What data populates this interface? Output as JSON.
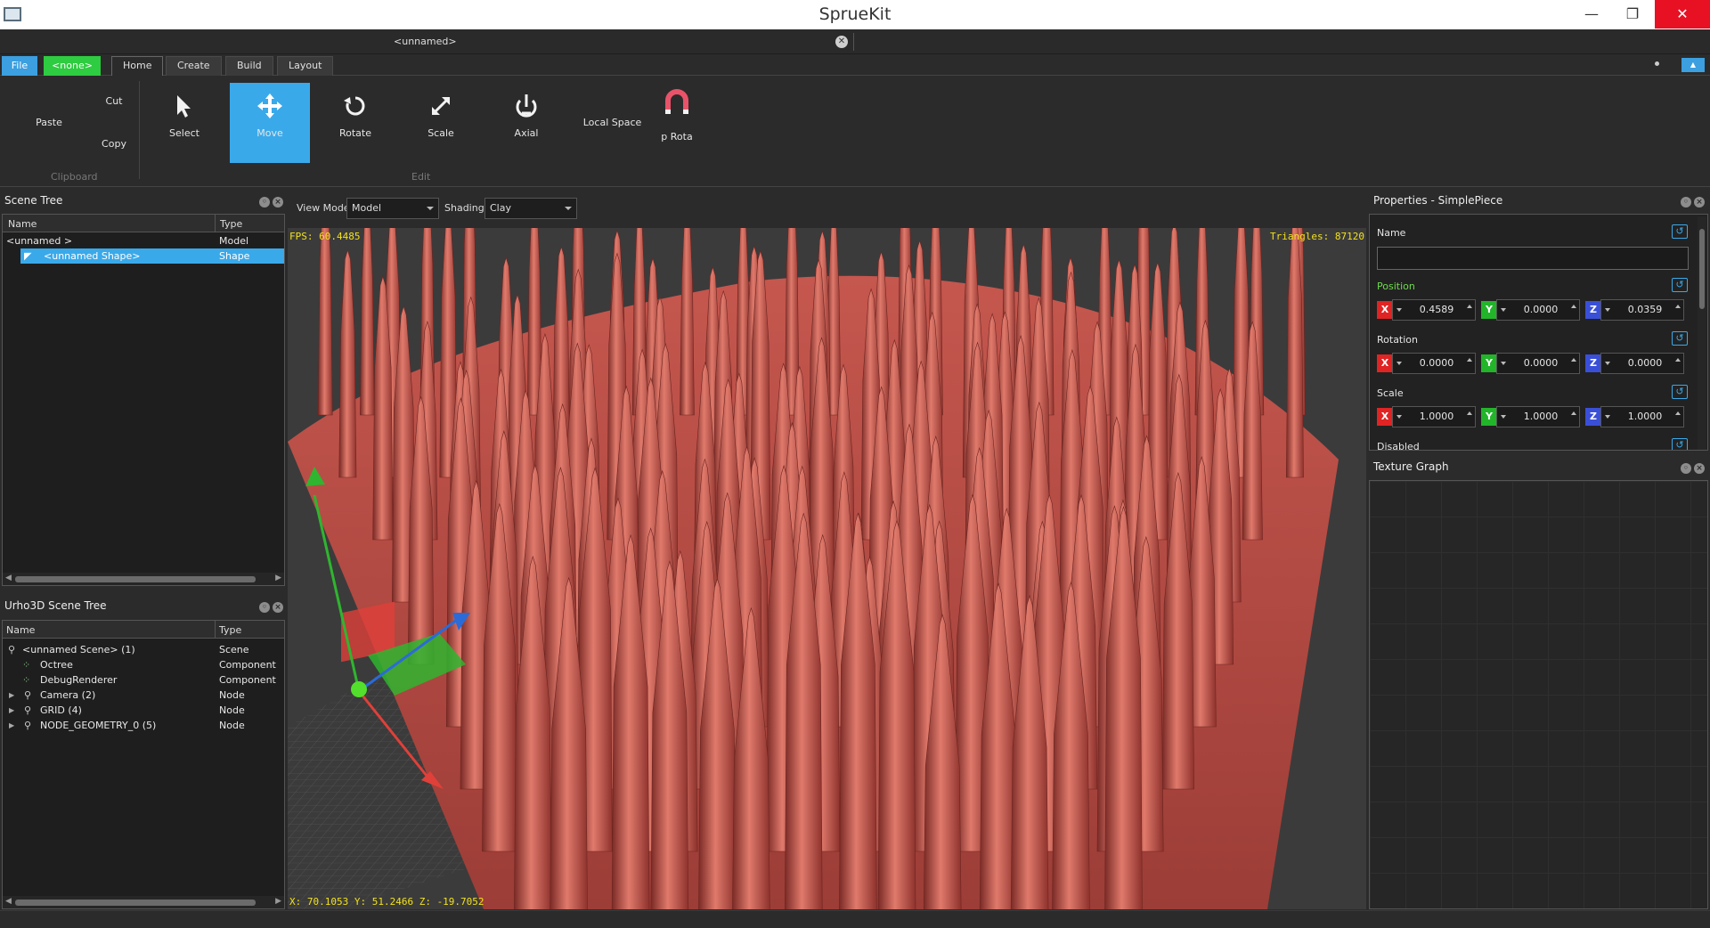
{
  "window": {
    "title": "SprueKit",
    "minimize": "—",
    "maximize": "❐",
    "close": "✕"
  },
  "document": {
    "tab_title": "<unnamed>",
    "close": "✕"
  },
  "ribbon_tabs": {
    "file": "File",
    "none": "<none>",
    "tabs": [
      "Home",
      "Create",
      "Build",
      "Layout"
    ]
  },
  "ribbon": {
    "clipboard": {
      "paste": "Paste",
      "cut": "Cut",
      "copy": "Copy",
      "group": "Clipboard"
    },
    "edit": {
      "select": "Select",
      "move": "Move",
      "rotate": "Rotate",
      "scale": "Scale",
      "axial": "Axial",
      "local_space": "Local Space",
      "p_rota": "p Rota",
      "group": "Edit"
    },
    "icons": {
      "select": "cursor-arrow-icon",
      "move": "move-arrows-icon",
      "rotate": "rotate-icon",
      "scale": "scale-arrow-icon",
      "axial": "axial-icon",
      "snap": "magnet-icon"
    }
  },
  "scene_tree": {
    "title": "Scene Tree",
    "columns": [
      "Name",
      "Type"
    ],
    "rows": [
      {
        "name": "<unnamed >",
        "type": "Model"
      },
      {
        "name": "<unnamed Shape>",
        "type": "Shape"
      }
    ]
  },
  "urho_tree": {
    "title": "Urho3D Scene Tree",
    "columns": [
      "Name",
      "Type"
    ],
    "rows": [
      {
        "name": "<unnamed Scene> (1)",
        "type": "Scene"
      },
      {
        "name": "Octree",
        "type": "Component"
      },
      {
        "name": "DebugRenderer",
        "type": "Component"
      },
      {
        "name": "Camera (2)",
        "type": "Node"
      },
      {
        "name": "GRID (4)",
        "type": "Node"
      },
      {
        "name": "NODE_GEOMETRY_0 (5)",
        "type": "Node"
      }
    ]
  },
  "viewport": {
    "view_mode_label": "View Mode",
    "view_mode": "Model",
    "shading_label": "Shading",
    "shading": "Clay",
    "fps": "FPS: 60.4485",
    "triangles": "Triangles: 87120",
    "coords": "X: 70.1053 Y: 51.2466 Z: -19.7052"
  },
  "properties": {
    "title": "Properties - SimplePiece",
    "name_label": "Name",
    "name_value": "",
    "position_label": "Position",
    "position": {
      "x": "0.4589",
      "y": "0.0000",
      "z": "0.0359"
    },
    "rotation_label": "Rotation",
    "rotation": {
      "x": "0.0000",
      "y": "0.0000",
      "z": "0.0000"
    },
    "scale_label": "Scale",
    "scale": {
      "x": "1.0000",
      "y": "1.0000",
      "z": "1.0000"
    },
    "disabled_label": "Disabled",
    "axis_x": "X",
    "axis_y": "Y",
    "axis_z": "Z",
    "reset": "↺"
  },
  "texture_graph": {
    "title": "Texture Graph"
  },
  "colors": {
    "accent": "#3aa9ea",
    "file_tab": "#3b9fe0",
    "none_tab": "#2ecc40",
    "hud": "#f2e21c",
    "mesh": "#c8504a"
  }
}
